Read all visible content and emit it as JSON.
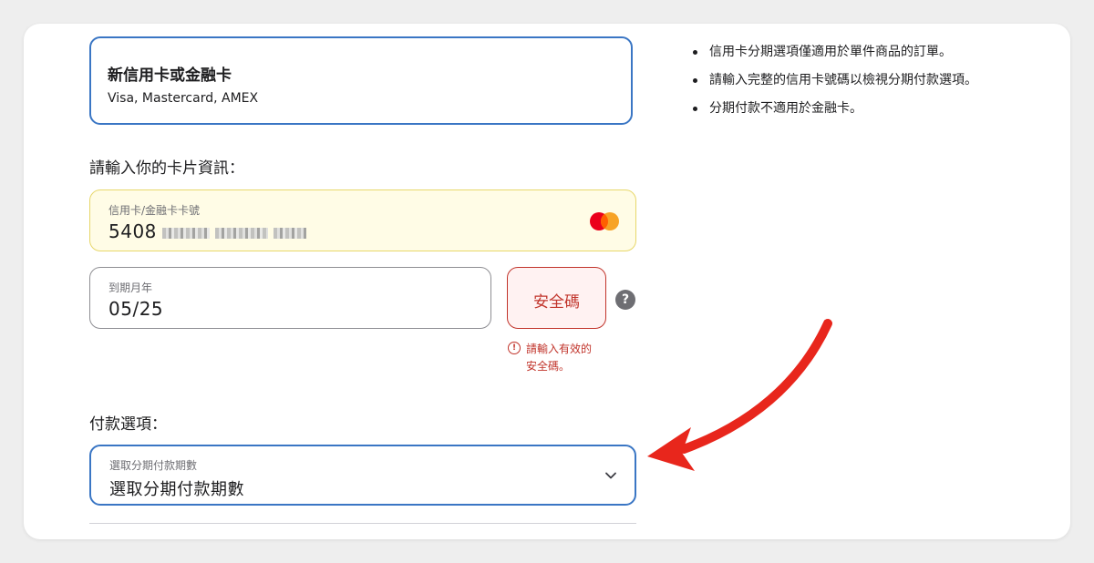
{
  "payment_option": {
    "title": "新信用卡或金融卡",
    "subtitle": "Visa, Mastercard, AMEX"
  },
  "card_info": {
    "heading": "請輸入你的卡片資訊：",
    "card_number": {
      "label": "信用卡/金融卡卡號",
      "value": "5408",
      "brand_icon": "mastercard-icon"
    },
    "expiry": {
      "label": "到期月年",
      "value": "05/25"
    },
    "security_code": {
      "placeholder": "安全碼",
      "error_line1": "請輸入有效的",
      "error_line2": "安全碼。"
    }
  },
  "payment_options": {
    "heading": "付款選項：",
    "installment": {
      "label": "選取分期付款期數",
      "value": "選取分期付款期數"
    }
  },
  "notes": [
    "信用卡分期選項僅適用於單件商品的訂單。",
    "請輸入完整的信用卡號碼以檢視分期付款選項。",
    "分期付款不適用於金融卡。"
  ],
  "colors": {
    "selected_border": "#3a76c4",
    "error": "#c1342b",
    "autofill_bg": "#fffce6",
    "annotation_arrow": "#e8261c"
  }
}
